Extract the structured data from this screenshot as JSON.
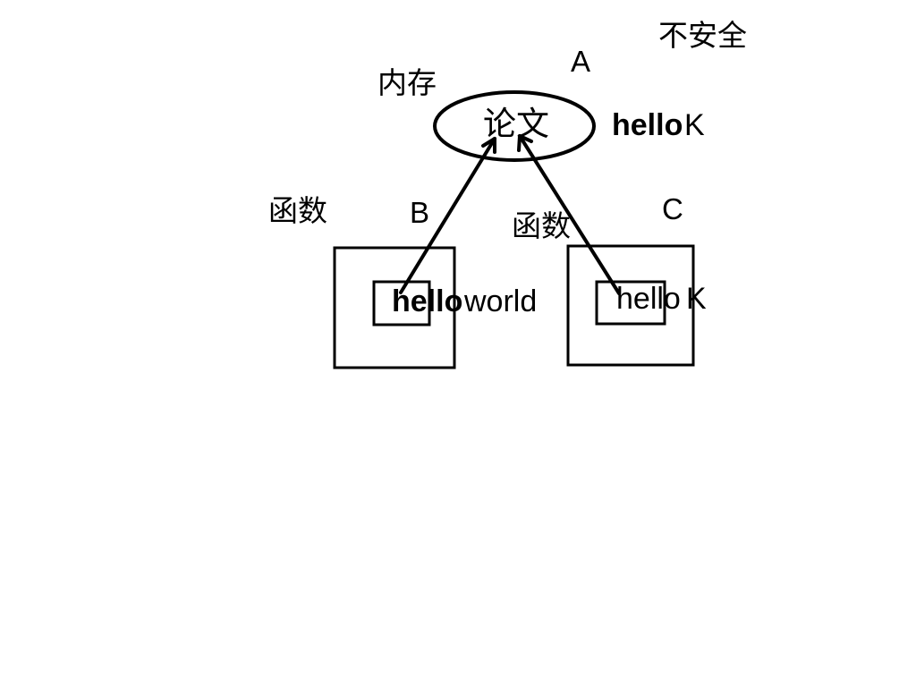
{
  "labels": {
    "insecure": "不安全",
    "a": "A",
    "memory": "内存",
    "paper": "论文",
    "hello_a": "hello",
    "k_a": "K",
    "func_left": "函数",
    "b": "B",
    "func_mid": "函数",
    "c": "C",
    "hello_b": "hello",
    "world_b": "world",
    "hello_c": "hello",
    "k_c": "K"
  }
}
